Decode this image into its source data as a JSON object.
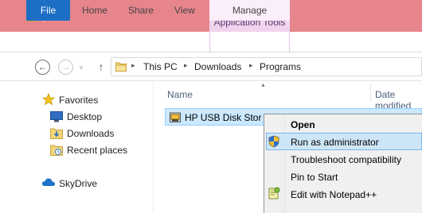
{
  "ribbon": {
    "context_group": "Application Tools",
    "tabs": {
      "file": "File",
      "home": "Home",
      "share": "Share",
      "view": "View",
      "manage": "Manage"
    },
    "quick_access_dropdown": "▾"
  },
  "nav_buttons": {
    "back": "←",
    "forward": "→",
    "recent": "∨",
    "up": "↑"
  },
  "address": {
    "breadcrumbs": [
      "This PC",
      "Downloads",
      "Programs"
    ],
    "separator": "▸"
  },
  "nav_pane": {
    "favorites": "Favorites",
    "desktop": "Desktop",
    "downloads": "Downloads",
    "recent_places": "Recent places",
    "skydrive": "SkyDrive"
  },
  "file_list": {
    "columns": {
      "name": "Name",
      "date": "Date modified"
    },
    "sort_indicator": "▲",
    "selected_file": "HP USB Disk Storage Format Tool"
  },
  "context_menu": {
    "open": "Open",
    "run_as_admin": "Run as administrator",
    "troubleshoot": "Troubleshoot compatibility",
    "pin_to_start": "Pin to Start",
    "edit_notepad": "Edit with Notepad++"
  },
  "colors": {
    "titlebar": "#e7858d",
    "file_tab": "#1c6fc4",
    "context_tab": "#f0d4ef",
    "selection": "#cce8ff",
    "menu_highlight": "#cde6f7"
  }
}
